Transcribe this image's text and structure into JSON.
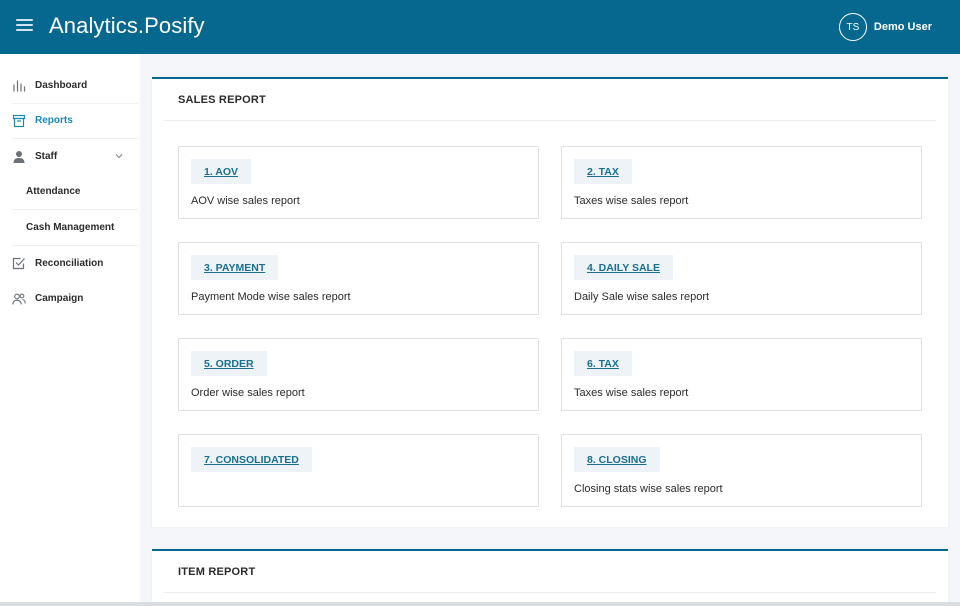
{
  "header": {
    "title": "Analytics.Posify",
    "avatar_initials": "TS",
    "user_name": "Demo User"
  },
  "sidebar": {
    "items": [
      {
        "label": "Dashboard",
        "icon": "bar-chart-icon"
      },
      {
        "label": "Reports",
        "icon": "archive-icon",
        "active": true
      },
      {
        "label": "Staff",
        "icon": "person-icon",
        "expandable": true
      },
      {
        "label": "Attendance",
        "sub": true
      },
      {
        "label": "Cash Management",
        "sub": true
      },
      {
        "label": "Reconciliation",
        "icon": "checkbox-icon"
      },
      {
        "label": "Campaign",
        "icon": "users-icon"
      }
    ]
  },
  "sales_report": {
    "title": "SALES REPORT",
    "cards": [
      {
        "tag": "1. AOV",
        "desc": "AOV wise sales report"
      },
      {
        "tag": "2. TAX",
        "desc": "Taxes wise sales report"
      },
      {
        "tag": "3. PAYMENT",
        "desc": "Payment Mode wise sales report"
      },
      {
        "tag": "4. DAILY SALE",
        "desc": "Daily Sale wise sales report"
      },
      {
        "tag": "5. ORDER",
        "desc": "Order wise sales report"
      },
      {
        "tag": "6. TAX",
        "desc": "Taxes wise sales report"
      },
      {
        "tag": "7. CONSOLIDATED",
        "desc": ""
      },
      {
        "tag": "8. CLOSING",
        "desc": "Closing stats wise sales report"
      }
    ]
  },
  "item_report": {
    "title": "ITEM REPORT"
  },
  "colors": {
    "header_bg": "#07688f",
    "accent": "#1a8ab3",
    "tag_bg": "#eef3f7",
    "tag_text": "#1a6e8f"
  }
}
